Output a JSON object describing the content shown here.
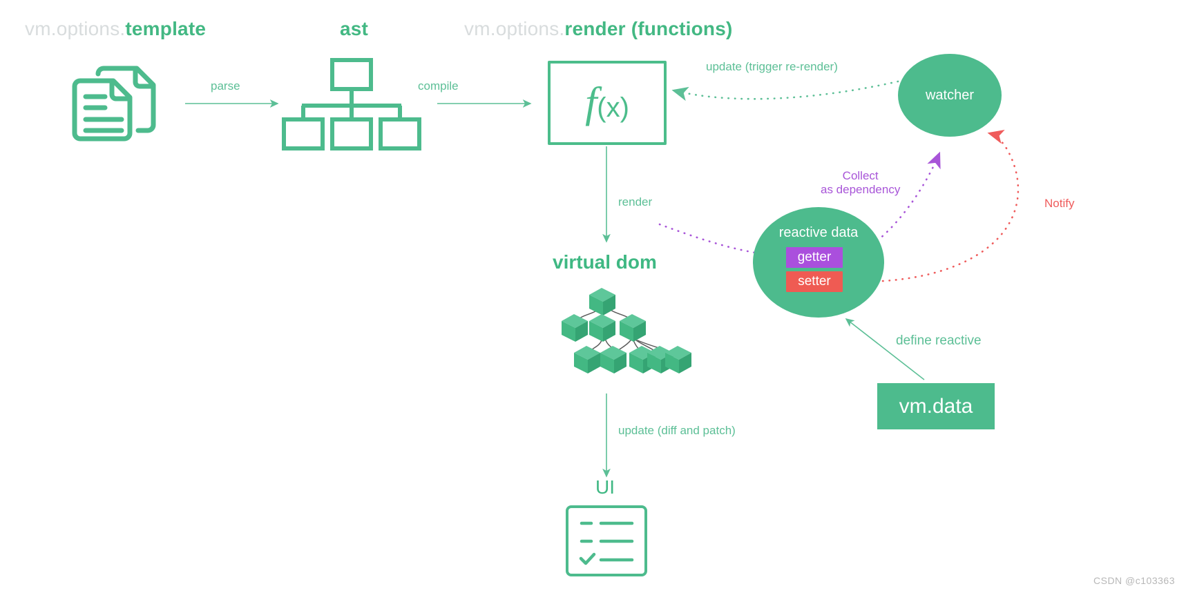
{
  "diagram": {
    "title": "Vue template compilation and reactivity flow",
    "colors": {
      "green": "#43b883",
      "green_light": "#4dbb8d",
      "green_edge": "#5cbf96",
      "grey_text": "#d8dcdd",
      "purple": "#a855d8",
      "purple_box": "#aa4fdd",
      "red": "#ef5b5b",
      "red_box": "#ef5b53",
      "white": "#ffffff",
      "cube_edge": "#5a5a5a"
    }
  },
  "headers": [
    {
      "dim": "vm.options.",
      "accent": "template"
    },
    {
      "dim": "",
      "accent": "ast"
    },
    {
      "dim": "vm.options.",
      "accent": "render (functions)"
    }
  ],
  "nodes": {
    "template_doc_icon": "documents-icon",
    "ast_tree_icon": "ast-tree-icon",
    "render_fn": {
      "f": "f",
      "x": "(x)"
    },
    "watcher": "watcher",
    "reactive_data": "reactive data",
    "getter": "getter",
    "setter": "setter",
    "vm_data": "vm.data",
    "virtual_dom": "virtual dom",
    "vdom_icon": "cube-tree-icon",
    "ui": "UI",
    "ui_icon": "checklist-icon"
  },
  "edges": [
    {
      "label": "parse",
      "style": "solid",
      "color": "#5cbf96"
    },
    {
      "label": "compile",
      "style": "solid",
      "color": "#5cbf96"
    },
    {
      "label": "render",
      "style": "solid",
      "color": "#5cbf96"
    },
    {
      "label": "update (trigger re-render)",
      "style": "dotted",
      "color": "#5cbf96"
    },
    {
      "label": "Collect\nas dependency",
      "style": "dotted",
      "color": "#a855d8"
    },
    {
      "label": "Notify",
      "style": "dotted",
      "color": "#ef5b5b"
    },
    {
      "label": "define reactive",
      "style": "solid",
      "color": "#5cbf96"
    },
    {
      "label": "update (diff and patch)",
      "style": "solid",
      "color": "#5cbf96"
    }
  ],
  "edge_labels": {
    "parse": "parse",
    "compile": "compile",
    "render": "render",
    "update_rerender": "update (trigger re-render)",
    "collect_line1": "Collect",
    "collect_line2": "as dependency",
    "notify": "Notify",
    "define_reactive": "define reactive",
    "update_diff_patch": "update (diff and patch)"
  },
  "watermark": "CSDN @c103363"
}
